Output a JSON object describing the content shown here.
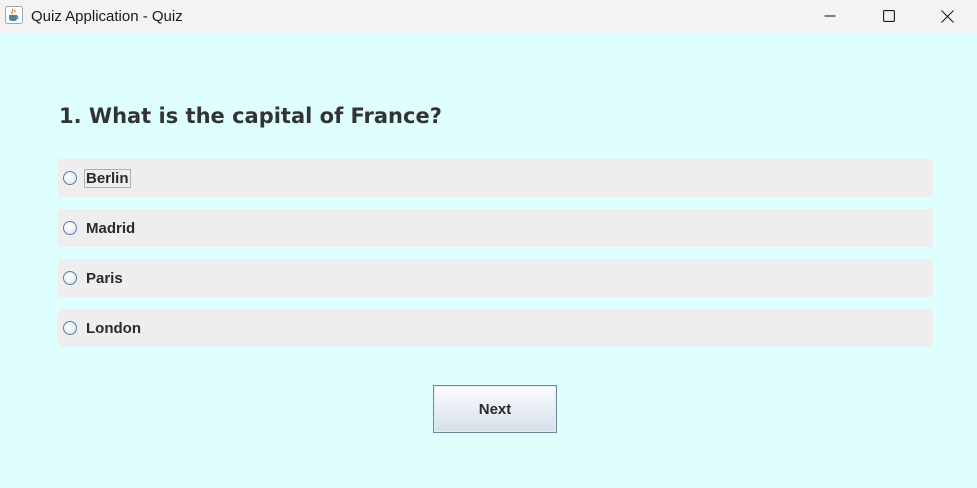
{
  "window": {
    "title": "Quiz Application - Quiz",
    "icon": "java-cup-icon",
    "controls": [
      "minimize-icon",
      "maximize-icon",
      "close-icon"
    ]
  },
  "quiz": {
    "question": "1. What is the capital of France?",
    "options": [
      {
        "label": "Berlin",
        "selected": false,
        "focused": true
      },
      {
        "label": "Madrid",
        "selected": false
      },
      {
        "label": "Paris",
        "selected": false
      },
      {
        "label": "London",
        "selected": false
      }
    ],
    "next_label": "Next"
  },
  "colors": {
    "background": "#dfffff",
    "option_row": "#eeeeee",
    "titlebar": "#f3f3f3",
    "text": "#333333"
  }
}
